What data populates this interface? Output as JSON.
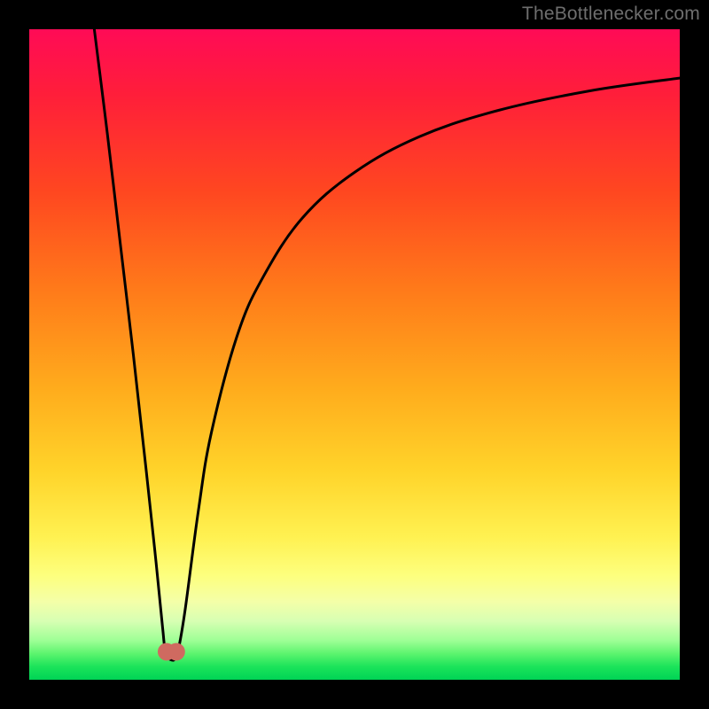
{
  "watermark": {
    "text": "TheBottlenecker.com"
  },
  "chart_data": {
    "type": "line",
    "title": "",
    "xlabel": "",
    "ylabel": "",
    "xlim": [
      0,
      100
    ],
    "ylim": [
      0,
      100
    ],
    "series": [
      {
        "name": "bottleneck-curve",
        "x": [
          10,
          12,
          14,
          16,
          18,
          19.5,
          20.5,
          21,
          22,
          22.5,
          23,
          24,
          26,
          28,
          32,
          36,
          42,
          50,
          60,
          72,
          86,
          100
        ],
        "values": [
          100,
          84,
          67,
          50,
          32,
          18,
          8,
          4,
          3,
          3.5,
          5,
          11,
          26,
          38,
          53,
          62,
          71,
          78,
          83.5,
          87.5,
          90.5,
          92.5
        ]
      }
    ],
    "markers": [
      {
        "name": "trough-marker-left",
        "x": 21.1,
        "y": 4.3,
        "color": "#cf6a60",
        "radius_pct": 1.35
      },
      {
        "name": "trough-marker-right",
        "x": 22.6,
        "y": 4.3,
        "color": "#cf6a60",
        "radius_pct": 1.35
      }
    ],
    "background_gradient": {
      "stops": [
        {
          "pct": 0,
          "color": "#ff0b56"
        },
        {
          "pct": 25,
          "color": "#ff4720"
        },
        {
          "pct": 55,
          "color": "#ffab1c"
        },
        {
          "pct": 78,
          "color": "#fff151"
        },
        {
          "pct": 92,
          "color": "#c0ffa0"
        },
        {
          "pct": 100,
          "color": "#00d455"
        }
      ]
    }
  }
}
